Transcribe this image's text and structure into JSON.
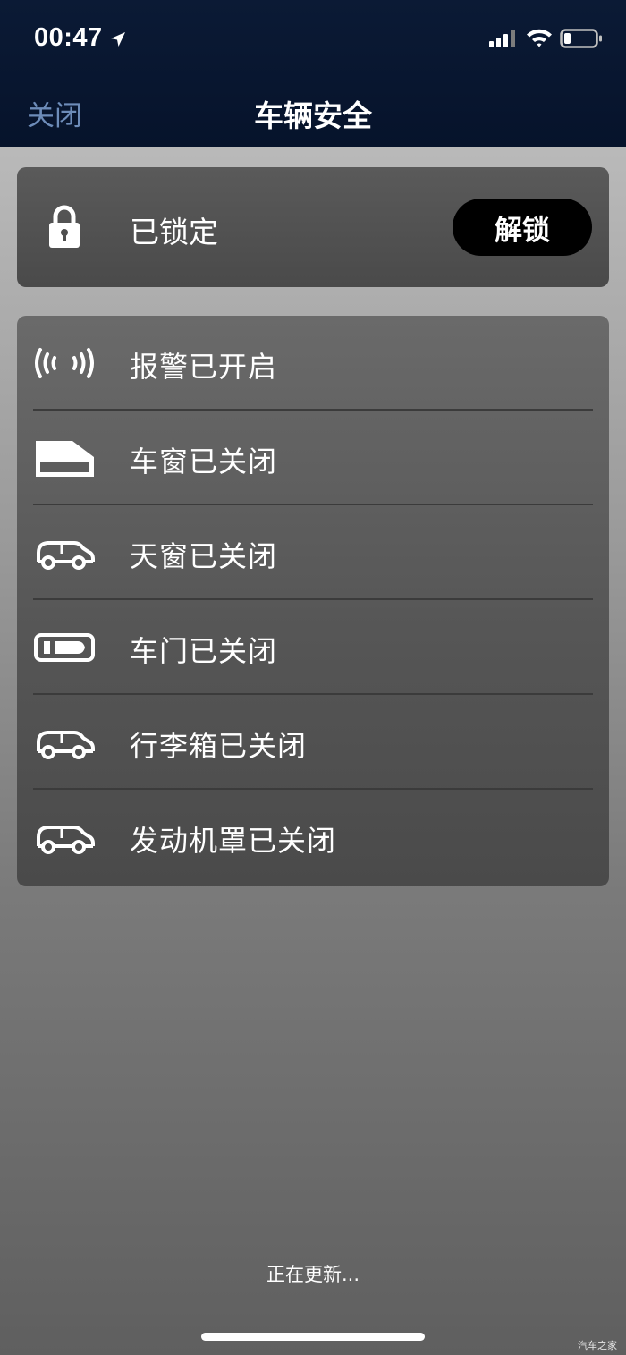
{
  "status_bar": {
    "time": "00:47",
    "location_icon": "location-arrow-icon",
    "signal_icon": "cellular-signal-icon",
    "wifi_icon": "wifi-icon",
    "battery_icon": "battery-low-icon"
  },
  "nav": {
    "close_label": "关闭",
    "title": "车辆安全"
  },
  "lock": {
    "icon": "padlock-icon",
    "status_label": "已锁定",
    "unlock_label": "解锁"
  },
  "statuses": [
    {
      "icon": "alarm-waves-icon",
      "label": "报警已开启"
    },
    {
      "icon": "car-window-icon",
      "label": "车窗已关闭"
    },
    {
      "icon": "car-sunroof-icon",
      "label": "天窗已关闭"
    },
    {
      "icon": "car-door-icon",
      "label": "车门已关闭"
    },
    {
      "icon": "car-trunk-icon",
      "label": "行李箱已关闭"
    },
    {
      "icon": "car-hood-icon",
      "label": "发动机罩已关闭"
    }
  ],
  "footer": {
    "updating_text": "正在更新...",
    "watermark": "汽车之家"
  },
  "colors": {
    "top_bar": "#06132b",
    "close_link": "#6d8cb9",
    "unlock_button": "#000000"
  }
}
